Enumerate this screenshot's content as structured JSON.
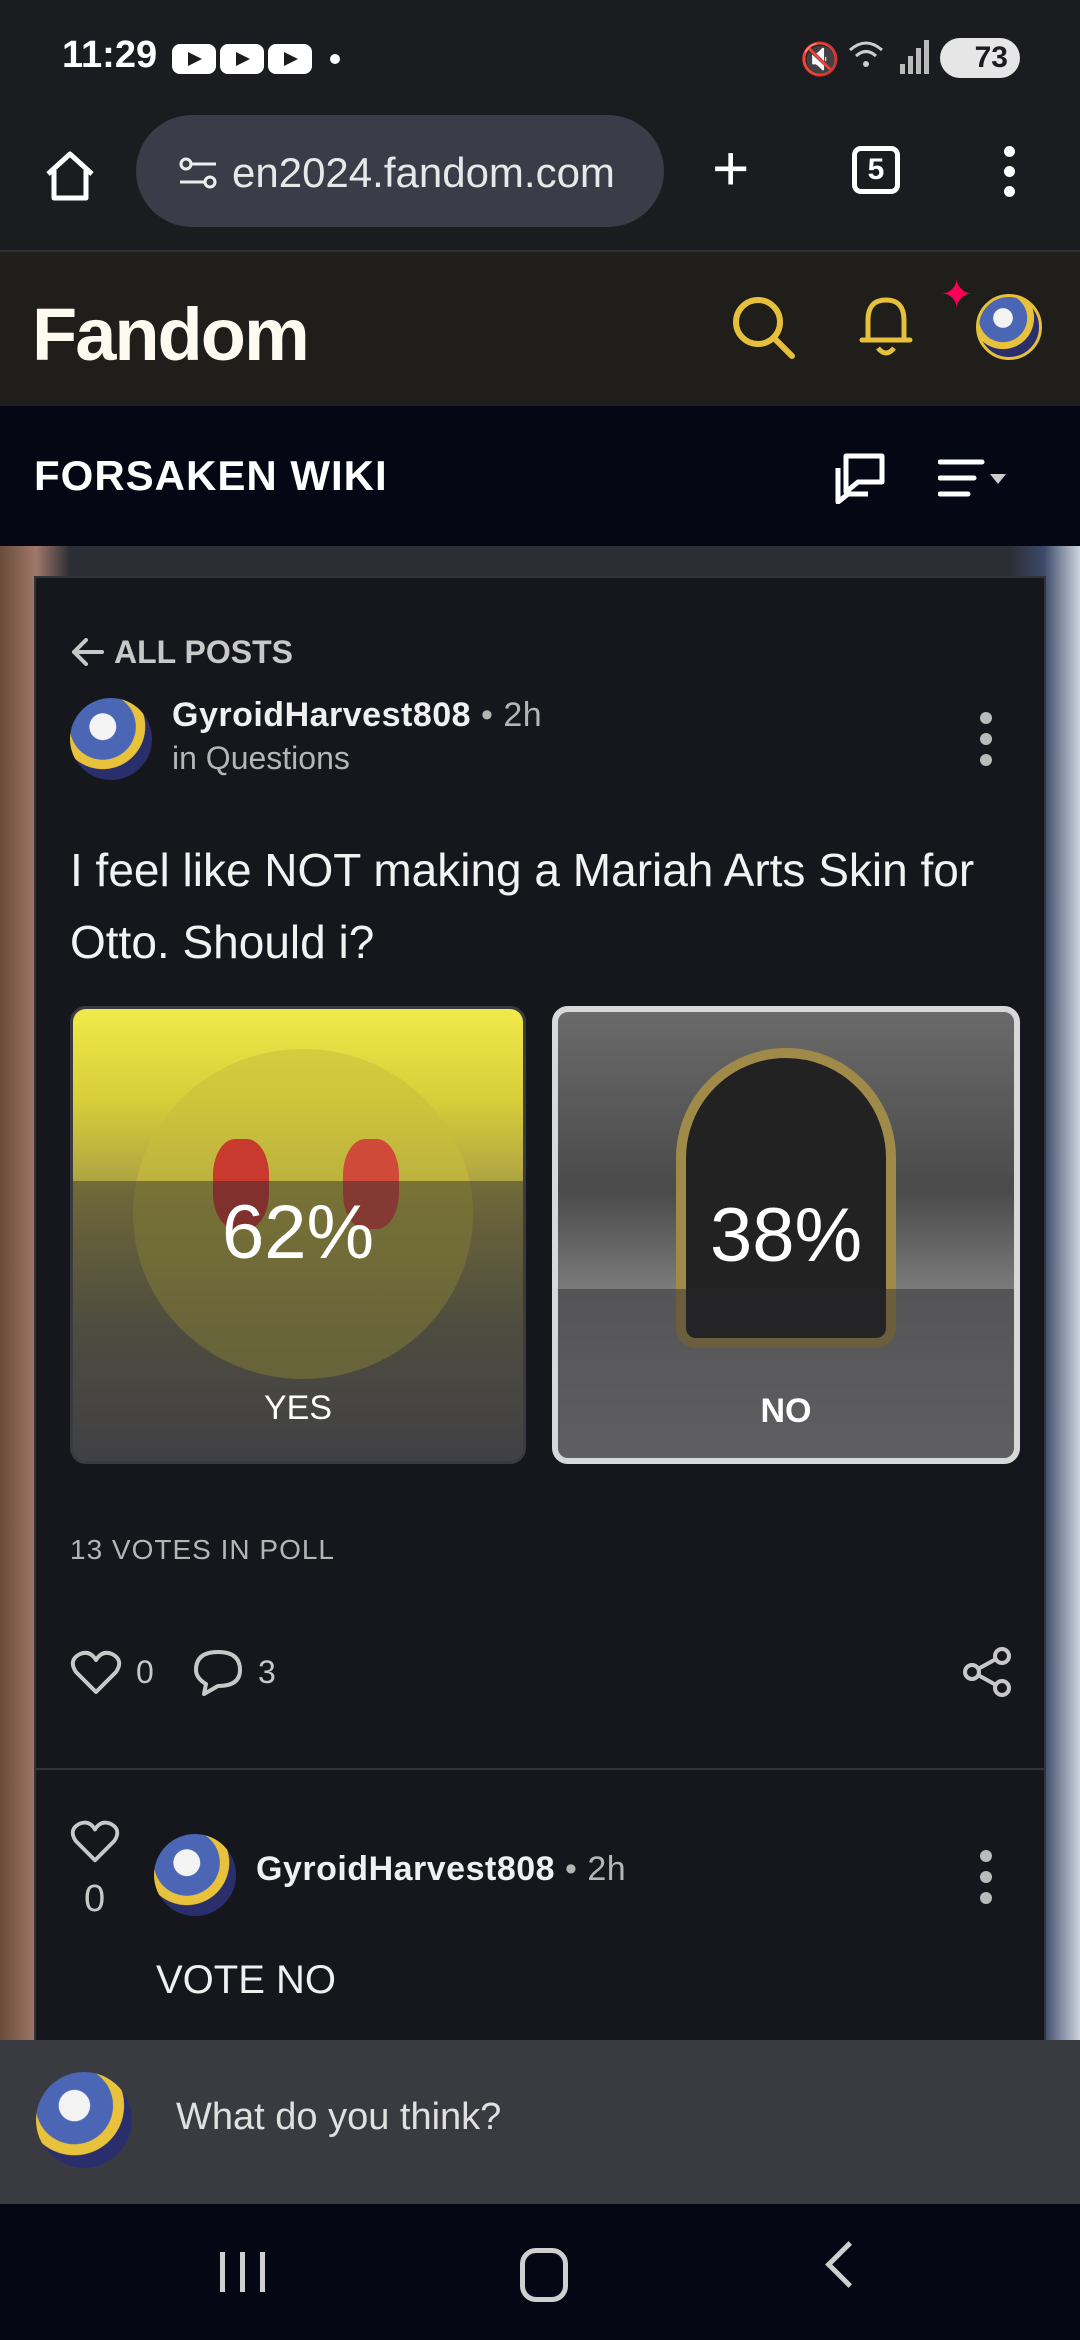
{
  "status_bar": {
    "time": "11:29",
    "battery": "73"
  },
  "browser": {
    "url": "en2024.fandom.com",
    "tab_count": "5"
  },
  "fandom_header": {
    "logo_text": "Fandom"
  },
  "wiki": {
    "title": "FORSAKEN WIKI"
  },
  "post": {
    "back_label": "ALL POSTS",
    "author": "GyroidHarvest808",
    "separator": "•",
    "time_ago": "2h",
    "category": "in Questions",
    "question": "I feel like NOT making a Mariah Arts Skin for Otto. Should i?",
    "poll": {
      "options": [
        {
          "label": "YES",
          "percent": "62%",
          "fraction": 0.62
        },
        {
          "label": "NO",
          "percent": "38%",
          "fraction": 0.38,
          "selected": true
        }
      ],
      "votes_text": "13 VOTES IN POLL"
    },
    "likes": "0",
    "comments": "3"
  },
  "reply": {
    "likes": "0",
    "author": "GyroidHarvest808",
    "separator": "•",
    "time_ago": "2h",
    "text": "VOTE NO"
  },
  "composer": {
    "placeholder": "What do you think?"
  },
  "colors": {
    "fandom_pink": "#fa005a",
    "fandom_yellow": "#e6c03a",
    "card_bg": "#16171c"
  }
}
